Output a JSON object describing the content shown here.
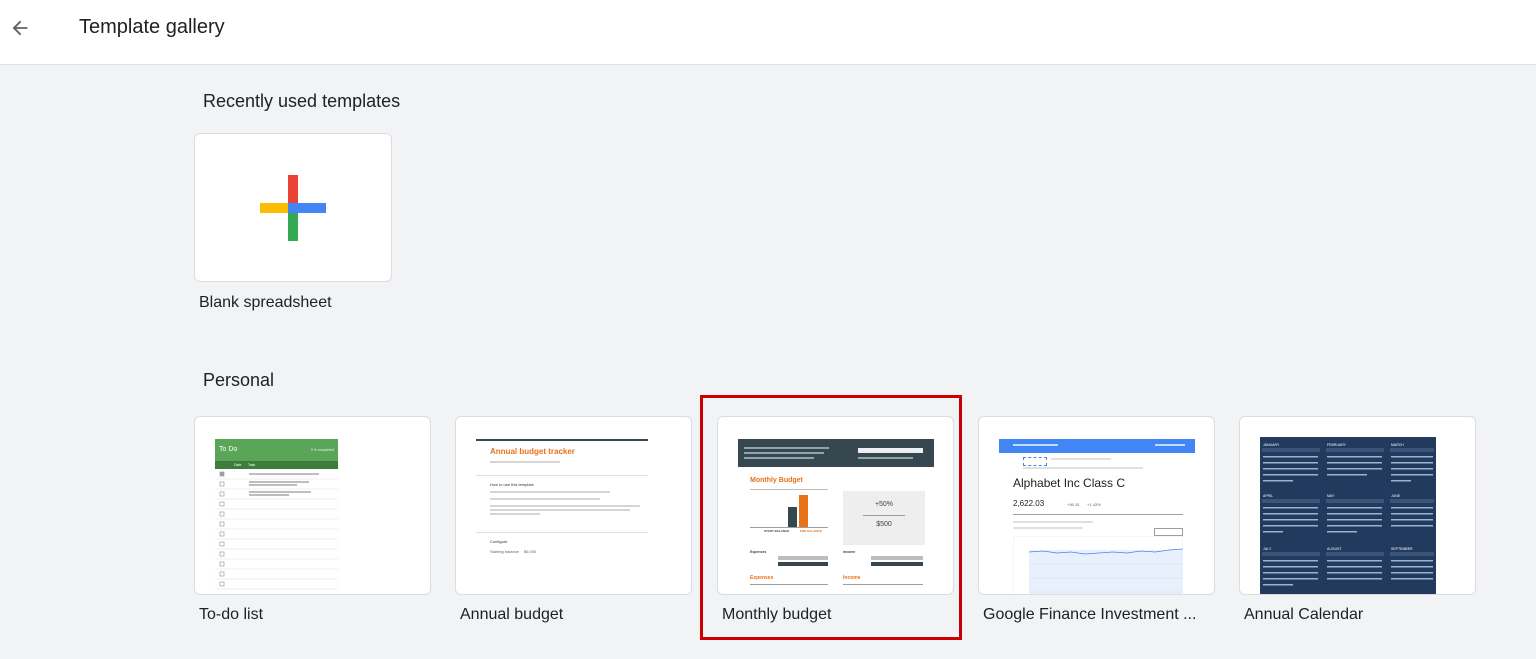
{
  "header": {
    "title": "Template gallery",
    "back_icon": "arrow-back-icon"
  },
  "recent": {
    "title": "Recently used templates",
    "blank": {
      "label": "Blank spreadsheet",
      "icon": "plus-multicolor-icon"
    }
  },
  "personal": {
    "title": "Personal",
    "templates": [
      {
        "label": "To-do list",
        "thumb": {
          "header": "To Do",
          "sub": "0 % completed",
          "cols": [
            "Date",
            "Task"
          ]
        }
      },
      {
        "label": "Annual budget",
        "thumb": {
          "title": "Annual budget tracker",
          "section1": "How to use this template",
          "section2": "Configure",
          "field": "Starting balance",
          "value": "$5,000"
        }
      },
      {
        "label": "Monthly budget",
        "thumb": {
          "title": "Monthly Budget",
          "pct": "+50%",
          "amount": "$500",
          "left_label": "START BALANCE",
          "right_label": "END BALANCE",
          "expenses": "Expenses",
          "income": "Income"
        }
      },
      {
        "label": "Google Finance Investment ...",
        "thumb": {
          "company": "Alphabet Inc Class C",
          "price": "2,622.03",
          "change": "+36.15",
          "pct": "+1.43%"
        }
      },
      {
        "label": "Annual Calendar",
        "thumb": {
          "months": [
            "JANUARY",
            "FEBRUARY",
            "MARCH",
            "APRIL",
            "MAY",
            "JUNE",
            "JULY",
            "AUGUST",
            "SEPTEMBER"
          ]
        }
      }
    ]
  },
  "colors": {
    "selection": "#cc0000",
    "google_red": "#ea4335",
    "google_blue": "#4285f4",
    "google_green": "#34a853",
    "google_yellow": "#fbbc04"
  }
}
